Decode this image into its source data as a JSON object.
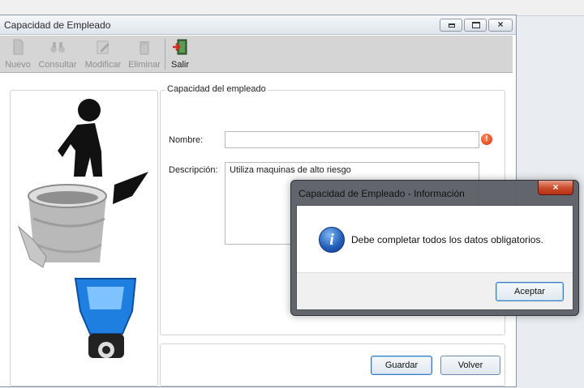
{
  "main_window": {
    "title": "Capacidad de Empleado",
    "controls": {
      "minimize": "minimize-icon",
      "maximize": "maximize-icon",
      "close": "×"
    }
  },
  "toolbar": {
    "nuevo": "Nuevo",
    "consultar": "Consultar",
    "modificar": "Modificar",
    "eliminar": "Eliminar",
    "salir": "Salir"
  },
  "form": {
    "legend": "Capacidad del empleado",
    "nombre_label": "Nombre:",
    "nombre_value": "",
    "descripcion_label": "Descripción:",
    "descripcion_value": "Utiliza maquinas de alto riesgo"
  },
  "buttons": {
    "guardar": "Guardar",
    "volver": "Volver"
  },
  "dialog": {
    "title": "Capacidad de Empleado - Información",
    "close": "×",
    "message": "Debe completar todos los datos obligatorios.",
    "accept": "Aceptar"
  },
  "colors": {
    "accent_blue": "#1f5bb8",
    "warning_red": "#d6340c",
    "bucket_blue": "#1e7fe0"
  }
}
